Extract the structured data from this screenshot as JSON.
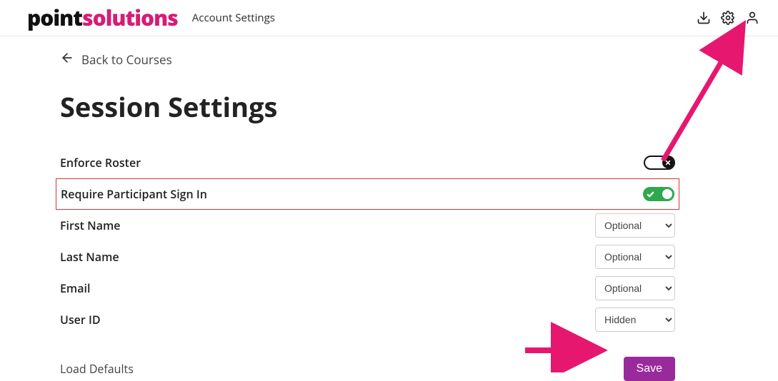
{
  "header": {
    "logo_part1": "point",
    "logo_part2": "solutions",
    "section_label": "Account Settings"
  },
  "back_link": "Back to Courses",
  "page_title": "Session Settings",
  "settings": {
    "enforce_roster": {
      "label": "Enforce Roster",
      "value": false
    },
    "require_signin": {
      "label": "Require Participant Sign In",
      "value": true
    },
    "first_name": {
      "label": "First Name",
      "value": "Optional"
    },
    "last_name": {
      "label": "Last Name",
      "value": "Optional"
    },
    "email": {
      "label": "Email",
      "value": "Optional"
    },
    "user_id": {
      "label": "User ID",
      "value": "Hidden"
    }
  },
  "footer": {
    "load_defaults": "Load Defaults",
    "save": "Save"
  },
  "colors": {
    "brand_pink": "#d61c77",
    "toggle_on": "#2fa84f",
    "save_btn": "#992a9c",
    "highlight": "#d73434",
    "arrow": "#e6176e"
  }
}
